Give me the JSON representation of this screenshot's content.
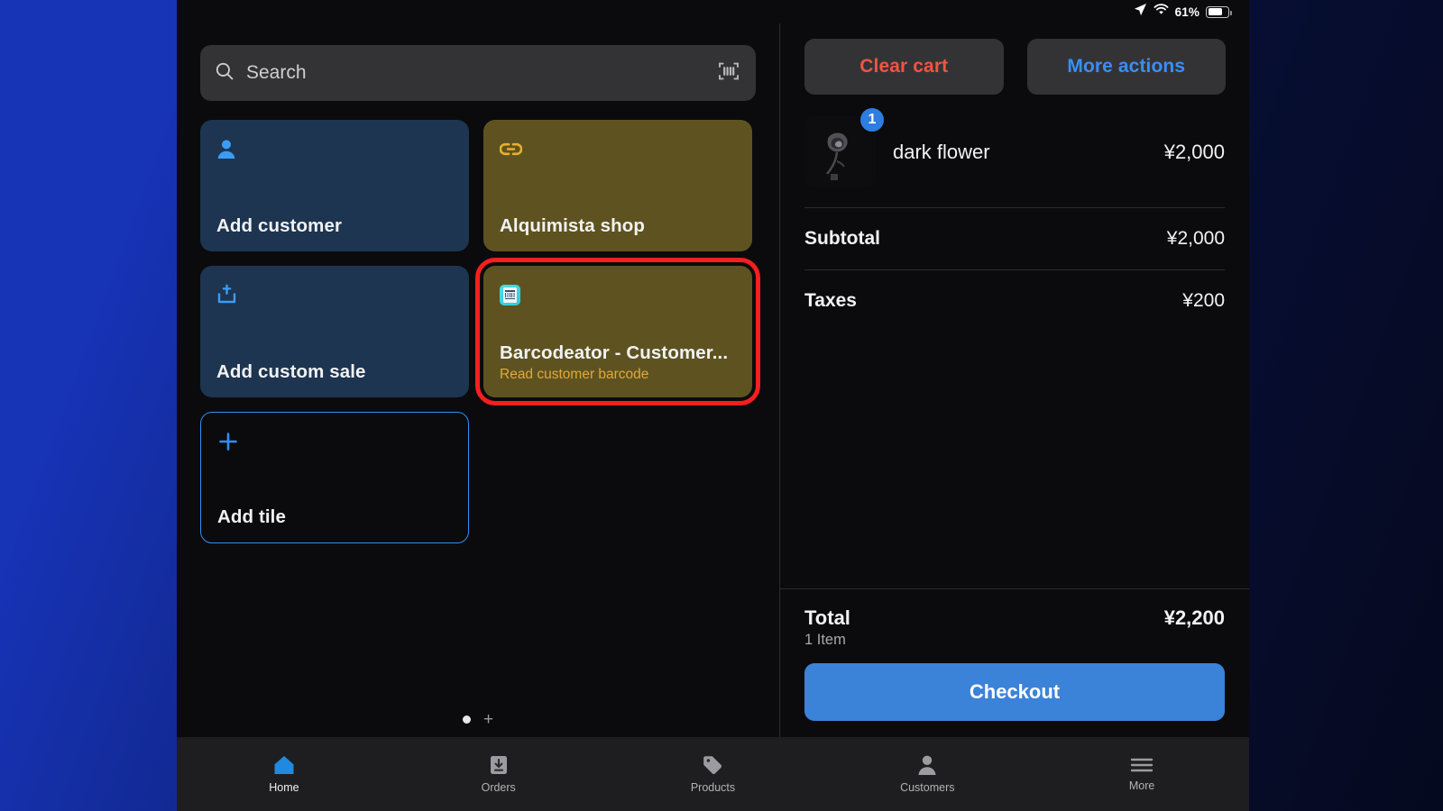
{
  "statusbar": {
    "battery_percent": "61%",
    "icons": [
      "location-arrow-icon",
      "wifi-icon",
      "battery-icon"
    ]
  },
  "search": {
    "placeholder": "Search",
    "scan_icon": "barcode-scan-icon"
  },
  "tiles": [
    {
      "title": "Add customer",
      "subtitle": "",
      "icon": "person-icon",
      "style": "blue",
      "highlighted": false
    },
    {
      "title": "Alquimista shop",
      "subtitle": "",
      "icon": "link-icon",
      "style": "olive",
      "highlighted": false
    },
    {
      "title": "Add custom sale",
      "subtitle": "",
      "icon": "tray-upload-icon",
      "style": "blue",
      "highlighted": false
    },
    {
      "title": "Barcodeator - Customer...",
      "subtitle": "Read customer barcode",
      "icon": "barcode-app-icon",
      "style": "olive",
      "highlighted": true
    },
    {
      "title": "Add tile",
      "subtitle": "",
      "icon": "plus-icon",
      "style": "outline",
      "highlighted": false
    }
  ],
  "pager": {
    "dots": 1,
    "add_label": "+"
  },
  "cart": {
    "clear_label": "Clear cart",
    "more_label": "More actions",
    "items": [
      {
        "name": "dark flower",
        "price": "¥2,000",
        "qty": "1",
        "thumb": "dark-rose-photo"
      }
    ],
    "lines": [
      {
        "label": "Subtotal",
        "value": "¥2,000"
      },
      {
        "label": "Taxes",
        "value": "¥200"
      }
    ],
    "total_label": "Total",
    "item_count": "1 Item",
    "total_value": "¥2,200",
    "checkout_label": "Checkout"
  },
  "tabbar": [
    {
      "label": "Home",
      "icon": "home-icon",
      "active": true
    },
    {
      "label": "Orders",
      "icon": "orders-icon",
      "active": false
    },
    {
      "label": "Products",
      "icon": "tag-icon",
      "active": false
    },
    {
      "label": "Customers",
      "icon": "person-icon",
      "active": false
    },
    {
      "label": "More",
      "icon": "hamburger-icon",
      "active": false
    }
  ],
  "colors": {
    "accent_blue": "#3b82d9",
    "danger_red": "#f0553f",
    "highlight_red": "#f41f1f",
    "tile_blue": "#1d3550",
    "tile_olive": "#5e5320",
    "subtitle_amber": "#e0a93a"
  }
}
